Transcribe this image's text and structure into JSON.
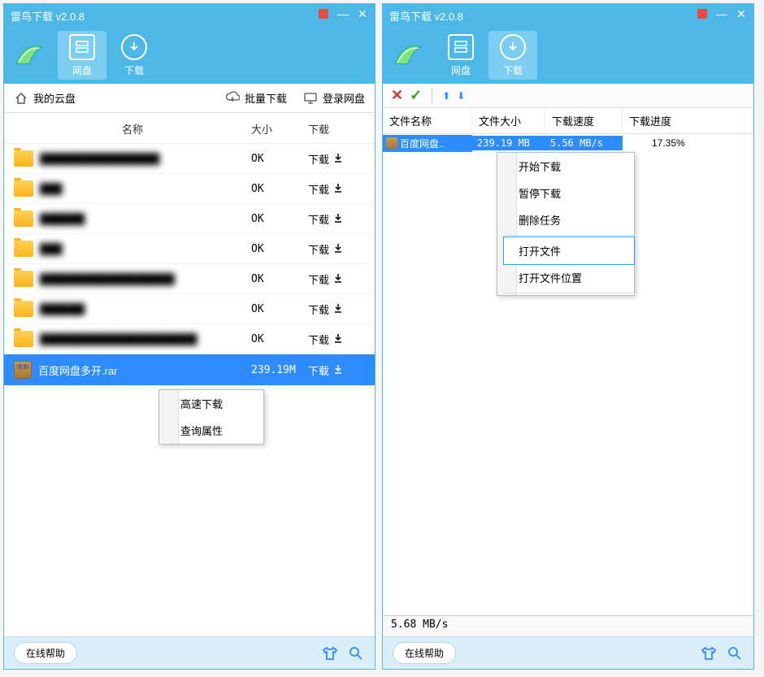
{
  "app": {
    "title": "雷鸟下载 v2.0.8"
  },
  "tabs": {
    "netdisk": "网盘",
    "download": "下载"
  },
  "left": {
    "breadcrumb": "我的云盘",
    "batch_download": "批量下载",
    "login_netdisk": "登录网盘",
    "headers": {
      "name": "名称",
      "size": "大小",
      "download": "下载"
    },
    "download_label": "下载",
    "rows": [
      {
        "name": "████████████████",
        "size": "OK",
        "blur": true,
        "type": "folder"
      },
      {
        "name": "███",
        "size": "OK",
        "blur": true,
        "type": "folder"
      },
      {
        "name": "██████",
        "size": "OK",
        "blur": true,
        "type": "folder"
      },
      {
        "name": "███",
        "size": "OK",
        "blur": true,
        "type": "folder"
      },
      {
        "name": "██████████████████",
        "size": "OK",
        "blur": true,
        "type": "folder"
      },
      {
        "name": "██████",
        "size": "OK",
        "blur": true,
        "type": "folder"
      },
      {
        "name": "█████████████████████",
        "size": "OK",
        "blur": true,
        "type": "folder"
      },
      {
        "name": "百度网盘多开.rar",
        "size": "239.19M",
        "blur": false,
        "type": "rar",
        "selected": true
      }
    ],
    "context_menu": {
      "items": [
        "高速下载",
        "查询属性"
      ]
    }
  },
  "right": {
    "headers": {
      "name": "文件名称",
      "size": "文件大小",
      "speed": "下载速度",
      "progress": "下载进度"
    },
    "row": {
      "name": "百度网盘..",
      "size": "239.19 MB",
      "speed": "5.56 MB/s",
      "progress": "17.35%",
      "progress_pct": 17.35
    },
    "context_menu": {
      "items": [
        "开始下载",
        "暂停下载",
        "删除任务",
        "打开文件",
        "打开文件位置"
      ],
      "highlighted": 3,
      "sep_after": [
        2,
        4
      ]
    },
    "statusbar": "5.68 MB/s"
  },
  "footer": {
    "help": "在线帮助"
  }
}
